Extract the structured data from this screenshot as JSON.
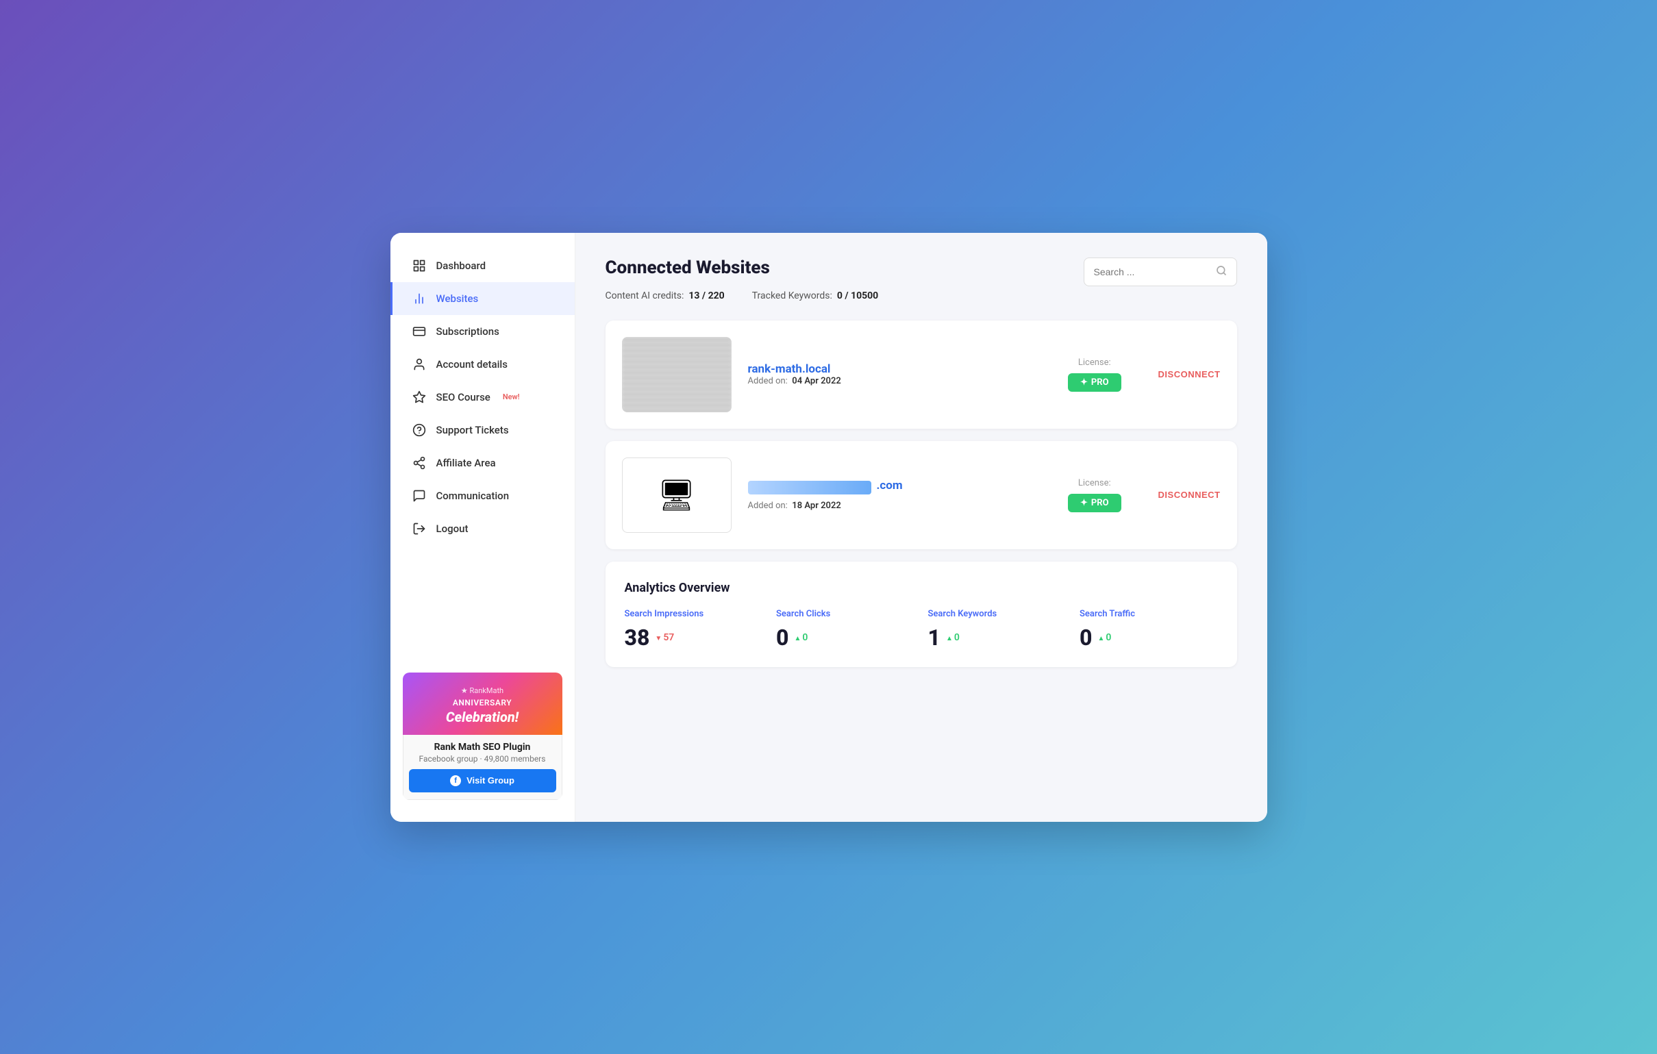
{
  "sidebar": {
    "items": [
      {
        "id": "dashboard",
        "label": "Dashboard",
        "icon": "🏠",
        "active": false
      },
      {
        "id": "websites",
        "label": "Websites",
        "icon": "📊",
        "active": true
      },
      {
        "id": "subscriptions",
        "label": "Subscriptions",
        "icon": "🖨",
        "active": false
      },
      {
        "id": "account",
        "label": "Account details",
        "icon": "👤",
        "active": false
      },
      {
        "id": "seo-course",
        "label": "SEO Course",
        "badge": "New!",
        "icon": "👑",
        "active": false
      },
      {
        "id": "support",
        "label": "Support Tickets",
        "icon": "🎫",
        "active": false
      },
      {
        "id": "affiliate",
        "label": "Affiliate Area",
        "icon": "🤝",
        "active": false
      },
      {
        "id": "communication",
        "label": "Communication",
        "icon": "💬",
        "active": false
      },
      {
        "id": "logout",
        "label": "Logout",
        "icon": "🚪",
        "active": false
      }
    ]
  },
  "promo": {
    "brand": "★ RankMath",
    "title": "ANNIVERSARY",
    "subtitle": "Celebration!",
    "plugin_name": "Rank Math SEO Plugin",
    "group_info": "Facebook group · 49,800 members",
    "visit_label": "Visit Group"
  },
  "header": {
    "title": "Connected Websites",
    "search_placeholder": "Search ..."
  },
  "credits": {
    "ai_label": "Content AI credits:",
    "ai_value": "13 / 220",
    "keywords_label": "Tracked Keywords:",
    "keywords_value": "0 / 10500"
  },
  "websites": [
    {
      "id": 1,
      "name": "rank-math.local",
      "name_type": "text",
      "added_label": "Added on:",
      "added_date": "04 Apr 2022",
      "license_label": "License:",
      "license": "PRO",
      "disconnect_label": "DISCONNECT"
    },
    {
      "id": 2,
      "name": ".com",
      "name_type": "blurred",
      "added_label": "Added on:",
      "added_date": "18 Apr 2022",
      "license_label": "License:",
      "license": "PRO",
      "disconnect_label": "DISCONNECT"
    }
  ],
  "analytics": {
    "title": "Analytics Overview",
    "items": [
      {
        "label": "Search Impressions",
        "value": "38",
        "delta": "57",
        "delta_dir": "down"
      },
      {
        "label": "Search Clicks",
        "value": "0",
        "delta": "0",
        "delta_dir": "up"
      },
      {
        "label": "Search Keywords",
        "value": "1",
        "delta": "0",
        "delta_dir": "up"
      },
      {
        "label": "Search Traffic",
        "value": "0",
        "delta": "0",
        "delta_dir": "up"
      }
    ]
  }
}
